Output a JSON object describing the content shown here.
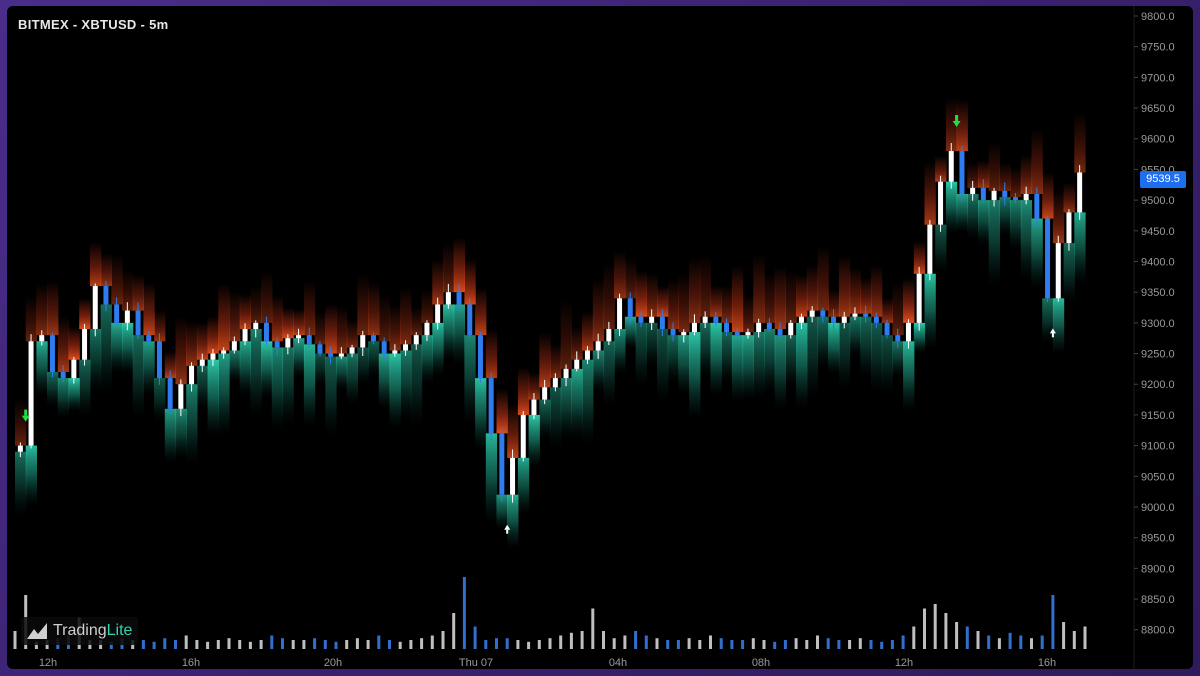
{
  "header": {
    "title": "BITMEX - XBTUSD - 5m"
  },
  "logo": {
    "word1": "Trading",
    "word2": "Lite"
  },
  "last_price": "9539.5",
  "colors": {
    "background": "#000000",
    "frame": "#3a2170",
    "bid_heat": "#2fd6b4",
    "ask_heat": "#e8401c",
    "candle_up": "#ffffff",
    "candle_down": "#2f7cf0",
    "volume_up": "#e0e0e0",
    "volume_down": "#3b82f0",
    "axis_text": "#9a9a9a",
    "signal_buy": "#ffffff",
    "signal_sell": "#22dd44",
    "price_tag": "#1e6ef0"
  },
  "chart_data": {
    "type": "line",
    "title": "BITMEX - XBTUSD - 5m",
    "ylim": [
      8780,
      9800
    ],
    "yticks": [
      9800,
      9750,
      9700,
      9650,
      9600,
      9550,
      9500,
      9450,
      9400,
      9350,
      9300,
      9250,
      9200,
      9150,
      9100,
      9050,
      9000,
      8950,
      8900,
      8850,
      8800
    ],
    "xlabels": [
      "12h",
      "16h",
      "20h",
      "Thu 07",
      "04h",
      "08h",
      "12h",
      "16h"
    ],
    "series": [
      {
        "values": [
          9090,
          9100,
          9270,
          9280,
          9220,
          9210,
          9240,
          9290,
          9360,
          9330,
          9300,
          9320,
          9280,
          9270,
          9210,
          9160,
          9200,
          9230,
          9240,
          9250,
          9255,
          9270,
          9290,
          9300,
          9270,
          9260,
          9275,
          9280,
          9265,
          9250,
          9245,
          9250,
          9260,
          9280,
          9270,
          9250,
          9255,
          9265,
          9280,
          9300,
          9330,
          9350,
          9330,
          9280,
          9210,
          9120,
          9020,
          9080,
          9150,
          9175,
          9195,
          9210,
          9225,
          9240,
          9255,
          9270,
          9290,
          9340,
          9310,
          9300,
          9310,
          9290,
          9280,
          9285,
          9300,
          9310,
          9300,
          9285,
          9280,
          9285,
          9300,
          9290,
          9280,
          9300,
          9310,
          9320,
          9310,
          9300,
          9310,
          9315,
          9310,
          9300,
          9280,
          9270,
          9300,
          9380,
          9460,
          9530,
          9580,
          9510,
          9520,
          9500,
          9515,
          9505,
          9500,
          9510,
          9470,
          9340,
          9430,
          9480,
          9545
        ]
      }
    ],
    "volume": [
      20,
      60,
      8,
      10,
      12,
      15,
      35,
      10,
      10,
      8,
      12,
      10,
      10,
      8,
      12,
      10,
      15,
      10,
      8,
      10,
      12,
      10,
      8,
      10,
      15,
      12,
      10,
      10,
      12,
      10,
      8,
      10,
      12,
      10,
      15,
      10,
      8,
      10,
      12,
      15,
      20,
      40,
      80,
      25,
      10,
      12,
      12,
      10,
      8,
      10,
      12,
      15,
      18,
      20,
      45,
      20,
      12,
      15,
      20,
      15,
      12,
      10,
      10,
      12,
      10,
      15,
      12,
      10,
      10,
      12,
      10,
      8,
      10,
      12,
      10,
      15,
      12,
      10,
      10,
      12,
      10,
      8,
      10,
      15,
      25,
      45,
      50,
      40,
      30,
      25,
      20,
      15,
      12,
      18,
      15,
      12,
      15,
      60,
      30,
      20,
      25
    ],
    "signals": [
      {
        "type": "sell",
        "index": 1
      },
      {
        "type": "buy",
        "index": 46
      },
      {
        "type": "sell",
        "index": 88
      },
      {
        "type": "buy",
        "index": 97
      }
    ],
    "grid": false
  }
}
